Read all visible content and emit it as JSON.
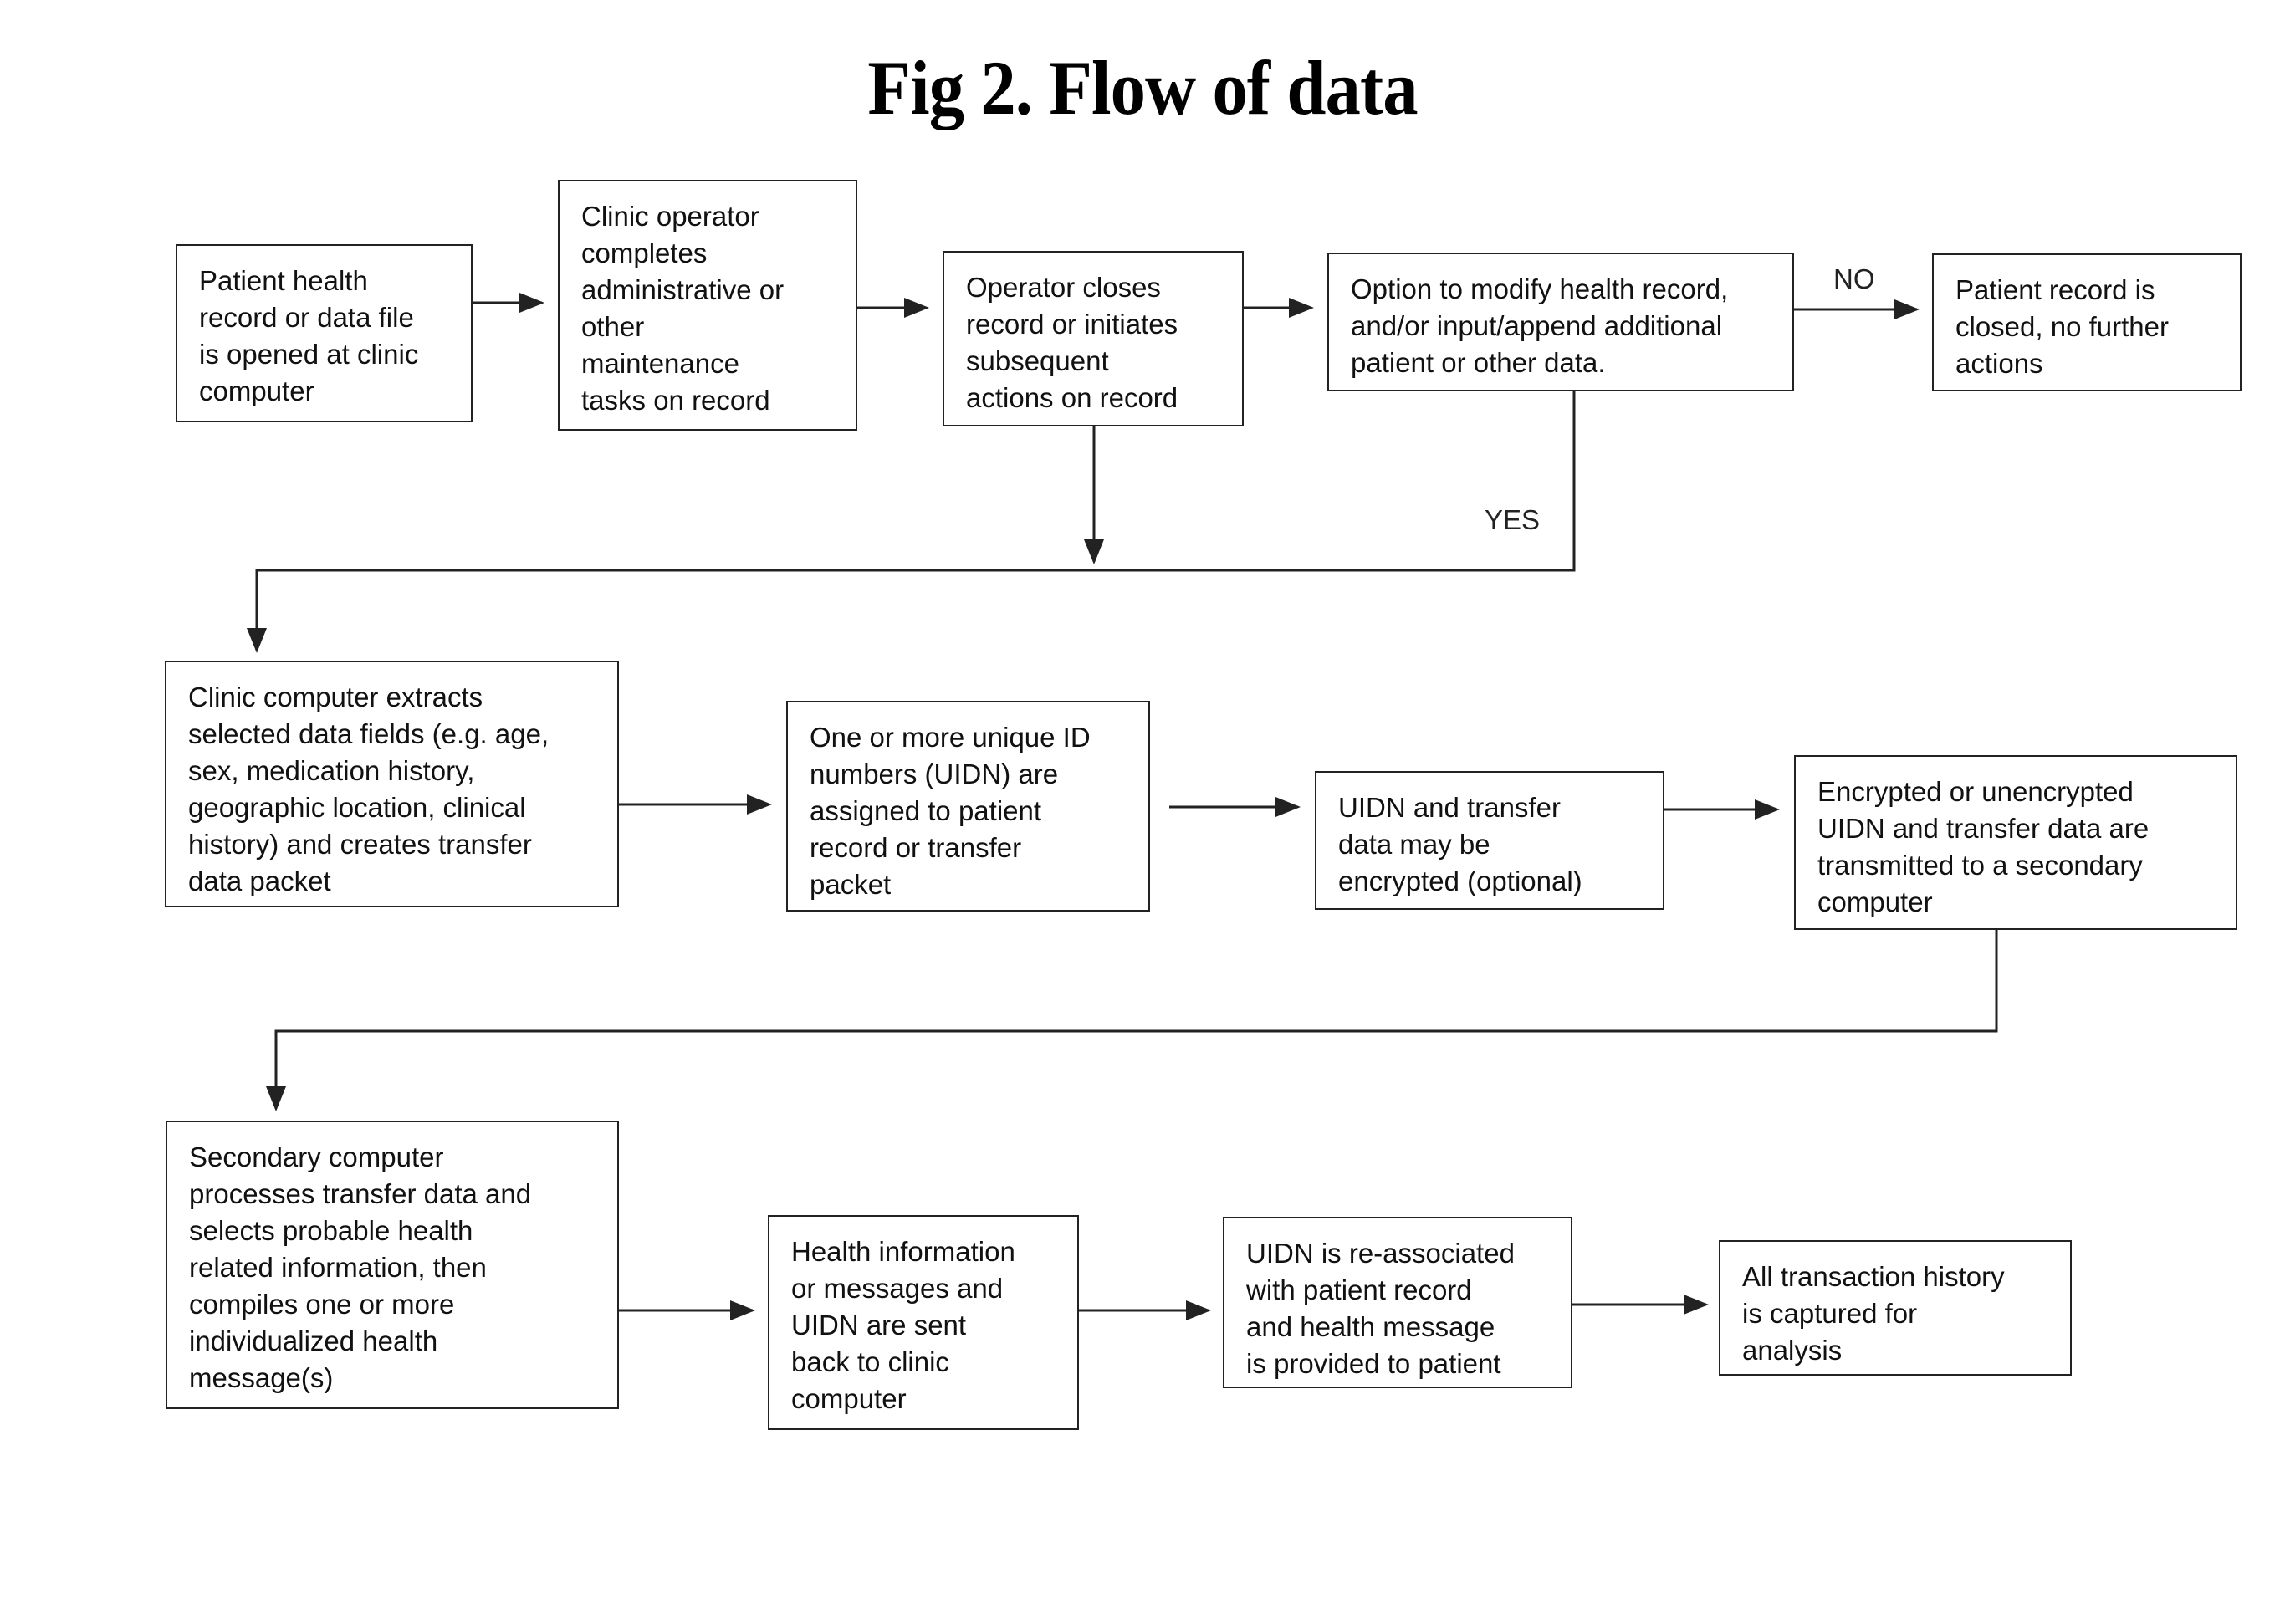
{
  "title": "Fig 2.  Flow of data",
  "nodes": [
    {
      "id": "n1",
      "text": "Patient health\nrecord or data file\nis opened at clinic\ncomputer"
    },
    {
      "id": "n2",
      "text": "Clinic operator\ncompletes\nadministrative or\nother\nmaintenance\ntasks on record"
    },
    {
      "id": "n3",
      "text": "Operator closes\nrecord or initiates\nsubsequent\nactions on record"
    },
    {
      "id": "n4",
      "text": "Option to modify health record,\nand/or input/append additional\npatient or other data."
    },
    {
      "id": "n5",
      "text": "Patient record is\nclosed, no further\nactions"
    },
    {
      "id": "n6",
      "text": "Clinic computer extracts\nselected data fields (e.g. age,\nsex, medication history,\ngeographic location, clinical\nhistory) and creates transfer\ndata packet"
    },
    {
      "id": "n7",
      "text": "One or more unique ID\nnumbers (UIDN) are\nassigned to patient\nrecord or transfer\npacket"
    },
    {
      "id": "n8",
      "text": "UIDN and transfer\ndata may be\nencrypted (optional)"
    },
    {
      "id": "n9",
      "text": "Encrypted or unencrypted\nUIDN and transfer data are\ntransmitted to a secondary\ncomputer"
    },
    {
      "id": "n10",
      "text": "Secondary computer\nprocesses transfer data and\nselects probable health\nrelated information, then\ncompiles one or more\nindividualized  health\nmessage(s)"
    },
    {
      "id": "n11",
      "text": "Health information\nor messages and\nUIDN are sent\nback to clinic\ncomputer"
    },
    {
      "id": "n12",
      "text": "UIDN is re-associated\nwith patient record\nand health message\nis provided to patient"
    },
    {
      "id": "n13",
      "text": "All transaction history\nis captured for\nanalysis"
    }
  ],
  "edges": [
    {
      "from": "n1",
      "to": "n2",
      "label": ""
    },
    {
      "from": "n2",
      "to": "n3",
      "label": ""
    },
    {
      "from": "n3",
      "to": "n4",
      "label": ""
    },
    {
      "from": "n4",
      "to": "n5",
      "label": "NO"
    },
    {
      "from": "n4",
      "to": "n6",
      "label": "YES"
    },
    {
      "from": "n3",
      "to": "n6",
      "label": ""
    },
    {
      "from": "n6",
      "to": "n7",
      "label": ""
    },
    {
      "from": "n7",
      "to": "n8",
      "label": ""
    },
    {
      "from": "n8",
      "to": "n9",
      "label": ""
    },
    {
      "from": "n9",
      "to": "n10",
      "label": ""
    },
    {
      "from": "n10",
      "to": "n11",
      "label": ""
    },
    {
      "from": "n11",
      "to": "n12",
      "label": ""
    },
    {
      "from": "n12",
      "to": "n13",
      "label": ""
    }
  ],
  "labels": {
    "no": "NO",
    "yes": "YES"
  },
  "colors": {
    "line": "#222222",
    "text": "#111111",
    "background": "#ffffff"
  }
}
